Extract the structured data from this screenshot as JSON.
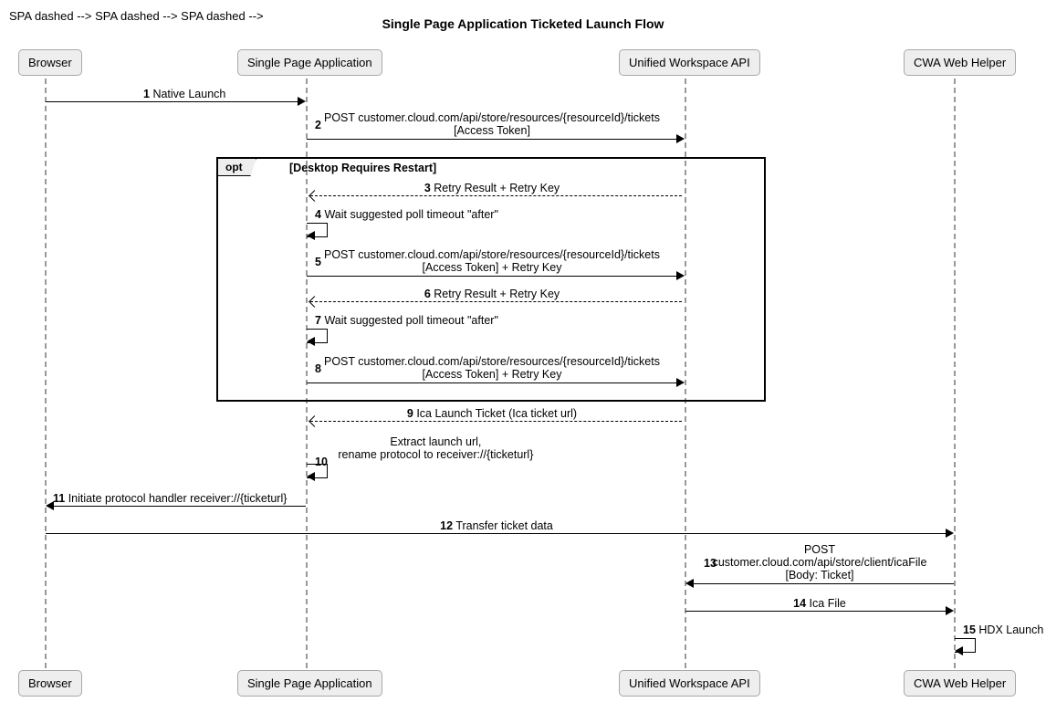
{
  "title": "Single Page Application Ticketed Launch Flow",
  "participants": {
    "browser": "Browser",
    "spa": "Single Page Application",
    "uwa": "Unified Workspace API",
    "cwa": "CWA Web Helper"
  },
  "opt": {
    "label": "opt",
    "condition": "[Desktop Requires Restart]"
  },
  "messages": {
    "m1": {
      "num": "1",
      "text": "Native Launch"
    },
    "m2": {
      "num": "2",
      "text": "POST customer.cloud.com/api/store/resources/{resourceId}/tickets",
      "sub": "[Access Token]"
    },
    "m3": {
      "num": "3",
      "text": "Retry Result + Retry Key"
    },
    "m4": {
      "num": "4",
      "text": "Wait suggested poll timeout \"after\""
    },
    "m5": {
      "num": "5",
      "text": "POST customer.cloud.com/api/store/resources/{resourceId}/tickets",
      "sub": "[Access Token] + Retry Key"
    },
    "m6": {
      "num": "6",
      "text": "Retry Result + Retry Key"
    },
    "m7": {
      "num": "7",
      "text": "Wait suggested poll timeout \"after\""
    },
    "m8": {
      "num": "8",
      "text": "POST customer.cloud.com/api/store/resources/{resourceId}/tickets",
      "sub": "[Access Token] + Retry Key"
    },
    "m9": {
      "num": "9",
      "text": "Ica Launch Ticket (Ica ticket url)"
    },
    "m10": {
      "num": "10",
      "text": "Extract launch url,",
      "sub": "rename protocol to receiver://{ticketurl}"
    },
    "m11": {
      "num": "11",
      "text": "Initiate protocol handler receiver://{ticketurl}"
    },
    "m12": {
      "num": "12",
      "text": "Transfer ticket data"
    },
    "m13": {
      "num": "13",
      "text": "POST",
      "sub": "customer.cloud.com/api/store/client/icaFile",
      "sub2": "[Body: Ticket]"
    },
    "m14": {
      "num": "14",
      "text": "Ica File"
    },
    "m15": {
      "num": "15",
      "text": "HDX Launch"
    }
  }
}
